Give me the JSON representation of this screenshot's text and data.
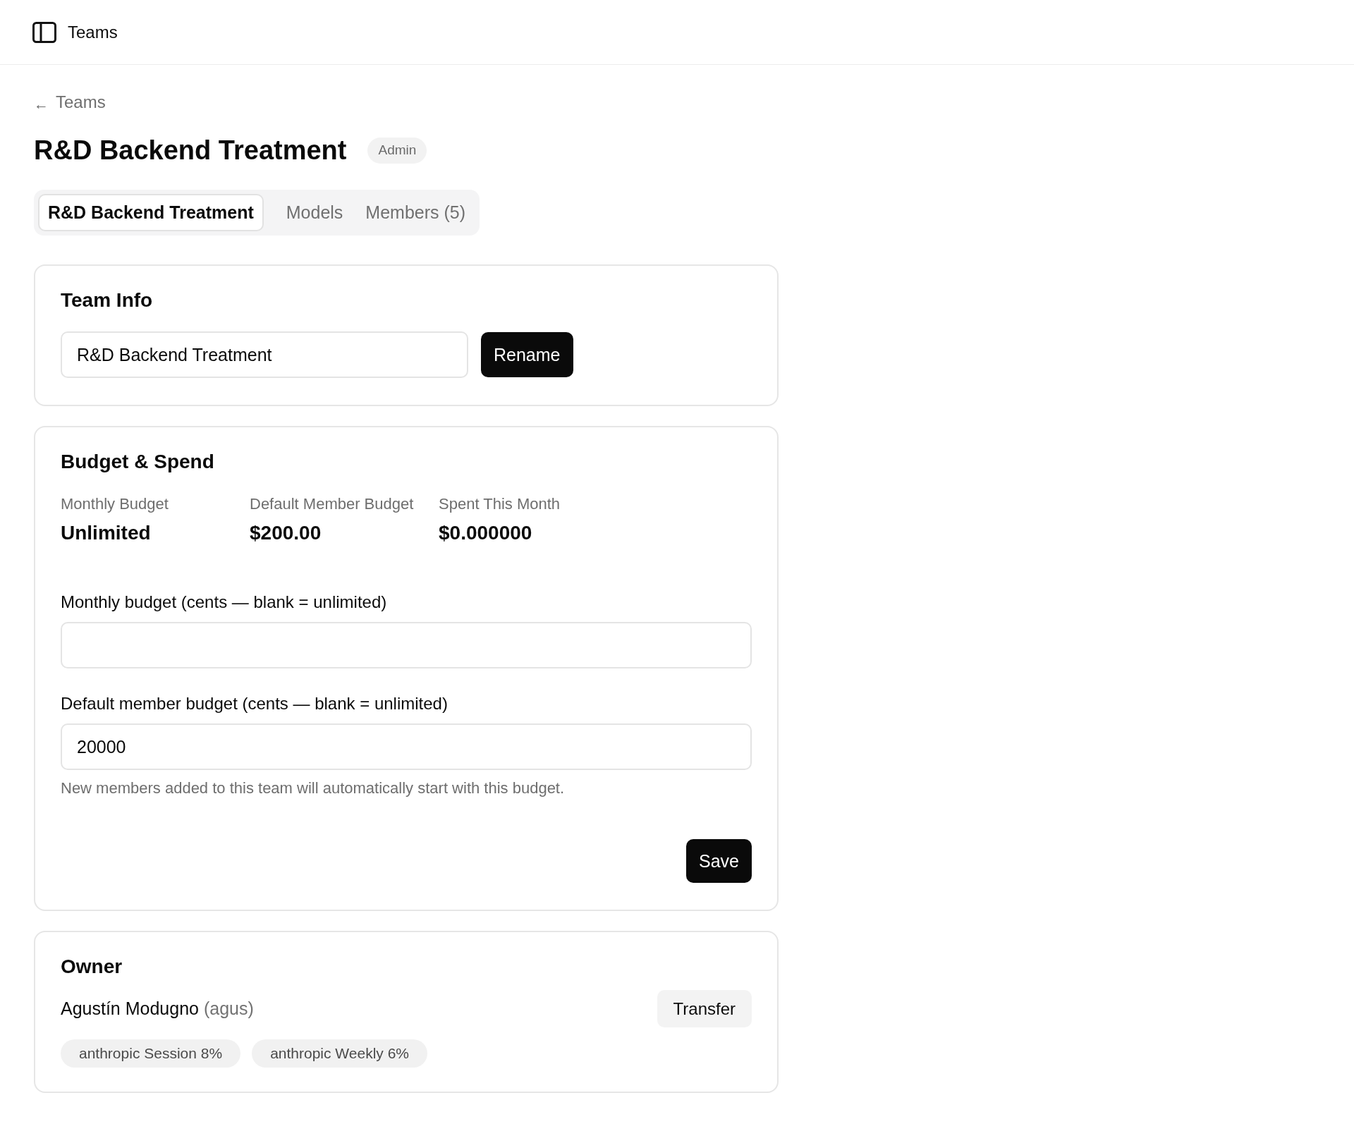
{
  "header": {
    "title": "Teams"
  },
  "back_link": {
    "icon": "←",
    "label": "Teams"
  },
  "page": {
    "title": "R&D Backend Treatment",
    "role_badge": "Admin"
  },
  "tabs": [
    {
      "label": "R&D Backend Treatment",
      "selected": true
    },
    {
      "label": "Models",
      "selected": false
    },
    {
      "label": "Members (5)",
      "selected": false
    }
  ],
  "team_info": {
    "title": "Team Info",
    "name_field": {
      "value": "R&D Backend Treatment"
    },
    "button": "Rename"
  },
  "budget": {
    "title": "Budget & Spend",
    "stats": [
      {
        "label": "Monthly Budget",
        "value": "Unlimited"
      },
      {
        "label": "Default Member Budget",
        "value": "$200.00"
      },
      {
        "label": "Spent This Month",
        "value": "$0.000000"
      }
    ],
    "fields": [
      {
        "label": "Monthly budget (cents — blank = unlimited)"
      },
      {
        "label": "Default member budget (cents — blank = unlimited)",
        "value": "20000",
        "hint": "New members added to this team will automatically start with this budget."
      }
    ],
    "button": "Save"
  },
  "owner": {
    "title": "Owner",
    "name": "Agustín Modugno",
    "username": "(agus)",
    "button": "Transfer",
    "usage_chips": [
      "anthropic Session 8%",
      "anthropic Weekly 6%"
    ]
  }
}
